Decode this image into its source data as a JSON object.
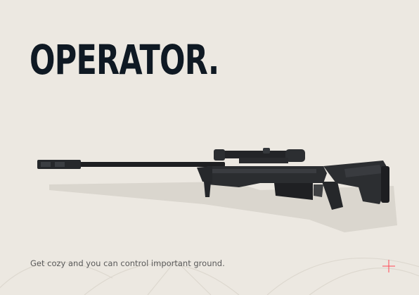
{
  "header": {
    "title": "OPERATOR."
  },
  "weapon": {
    "icon": "sniper-rifle-image"
  },
  "footer": {
    "description": "Get cozy and you can control important ground."
  },
  "decor": {
    "crosshair_icon": "crosshair-icon",
    "accent_color": "#ff4655"
  }
}
